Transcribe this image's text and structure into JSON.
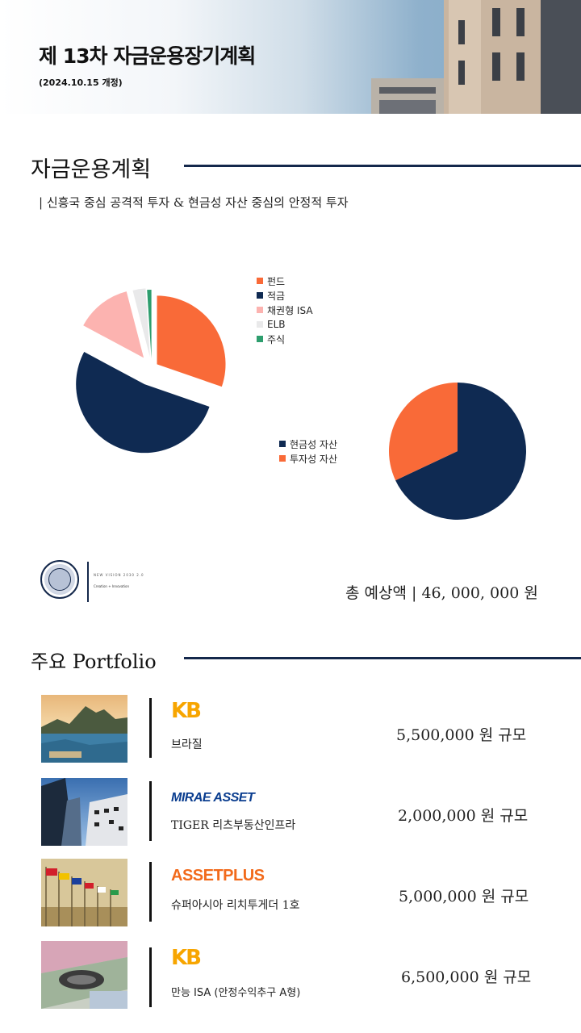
{
  "header": {
    "title": "제 13차 자금운용장기계획",
    "subtitle": "(2024.10.15 개정)"
  },
  "plan_section": {
    "title": "자금운용계획",
    "subheading": "| 신흥국 중심 공격적 투자 & 현금성 자산 중심의 안정적 투자"
  },
  "chart_data": [
    {
      "type": "pie",
      "categories": [
        "펀드",
        "적금",
        "채권형 ISA",
        "ELB",
        "주식"
      ],
      "values": [
        30,
        52,
        13,
        3,
        1
      ],
      "colors": [
        "#f96a38",
        "#0f2a52",
        "#fcb3b0",
        "#e9e9ea",
        "#2e9e6e"
      ],
      "legend_position": "right"
    },
    {
      "type": "pie",
      "categories": [
        "현금성 자산",
        "투자성 자산"
      ],
      "values": [
        68,
        32
      ],
      "colors": [
        "#0f2a52",
        "#f96a38"
      ],
      "legend_position": "left"
    }
  ],
  "logo": {
    "line1": "NEW VISION 2030 2.0",
    "line2": "Creation + Innovation"
  },
  "total": "총 예상액  |  46, 000, 000 원",
  "portfolio_section": {
    "title": "주요 Portfolio",
    "items": [
      {
        "brand": "KB",
        "name": "브라질",
        "amount": "5,500,000 원 규모"
      },
      {
        "brand": "MIRAE ASSET",
        "name": "TIGER 리츠부동산인프라",
        "amount": "2,000,000 원 규모"
      },
      {
        "brand": "ASSETPLUS",
        "name": "슈퍼아시아 리치투게더 1호",
        "amount": "5,000,000 원 규모"
      },
      {
        "brand": "KB",
        "name": "만능 ISA (안정수익추구 A형)",
        "amount": "6,500,000 원 규모"
      }
    ]
  }
}
